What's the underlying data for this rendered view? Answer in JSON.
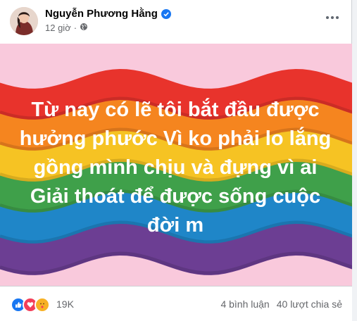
{
  "post": {
    "author": "Nguyễn Phương Hằng",
    "time": "12 giờ",
    "privacy_icon": "globe-icon",
    "verified_icon": "verified-badge-icon",
    "more_icon": "more-options-icon"
  },
  "image": {
    "text": "Từ nay có lẽ tôi bắt đầu được hưởng phước Vì ko phải lo lắng gồng mình chịu và đựng vì ai Giải thoát để được sống cuộc đời m",
    "colors": {
      "background": "#f9c9dc",
      "red": "#e8332c",
      "orange": "#f5851f",
      "yellow": "#f6c323",
      "green": "#3fa04a",
      "blue": "#1f86c8",
      "purple": "#6c3e93"
    }
  },
  "footer": {
    "reaction_icons": [
      "like-icon",
      "love-icon",
      "care-icon"
    ],
    "reaction_count": "19K",
    "comments": "4 bình luận",
    "shares": "40 lượt chia sẻ"
  },
  "colors": {
    "accent": "#1877f2",
    "text_primary": "#050505",
    "text_secondary": "#65676b"
  }
}
